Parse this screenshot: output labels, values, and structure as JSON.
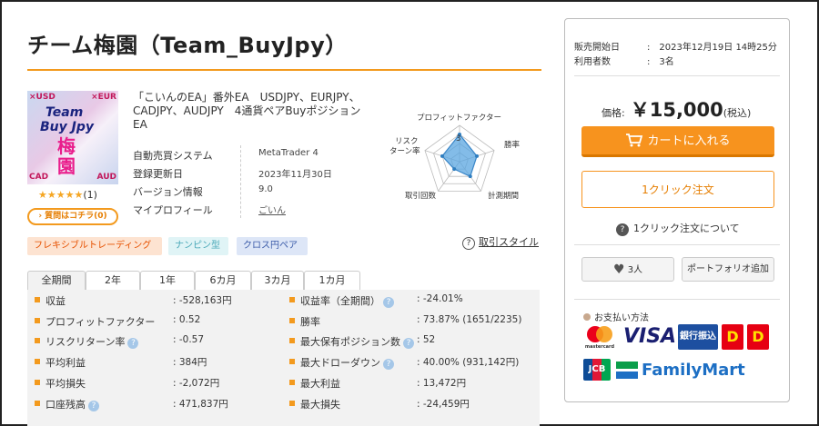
{
  "product": {
    "title": "チーム梅園（Team_BuyJpy）",
    "image_texts": {
      "tl": "×USD",
      "tr": "×EUR",
      "bl": "CAD",
      "br": "AUD",
      "line1": "Team",
      "line2": "Buy Jpy",
      "kanji": "梅園"
    },
    "stars": "★★★★★",
    "review_count": "(1)",
    "question_button": "質問はコチラ(0)",
    "description": "「こいんのEA」番外EA　USDJPY、EURJPY、CADJPY、AUDJPY　4通貨ペアBuyポジションEA"
  },
  "info": [
    {
      "key": "自動売買システム",
      "value": "MetaTrader 4"
    },
    {
      "key": "登録更新日",
      "value": "2023年11月30日"
    },
    {
      "key": "バージョン情報",
      "value": "9.0"
    },
    {
      "key": "マイプロフィール",
      "value": "ごいん"
    }
  ],
  "radar": {
    "axes": [
      "プロフィットファクター",
      "勝率",
      "計測期間",
      "取引回数",
      "リスク",
      "ターン率"
    ],
    "scale_label": "3",
    "values": [
      3,
      2,
      2,
      1,
      2
    ],
    "max": 4
  },
  "tags": [
    "フレキシブルトレーディング",
    "ナンピン型",
    "クロス円ペア"
  ],
  "trade_style_link": "取引スタイル",
  "tabs": [
    "全期間",
    "2年",
    "1年",
    "6カ月",
    "3カ月",
    "1カ月"
  ],
  "stats_left": [
    {
      "label": "収益",
      "value": ": -528,163円",
      "help": false
    },
    {
      "label": "プロフィットファクター",
      "value": ": 0.52",
      "help": false
    },
    {
      "label": "リスクリターン率",
      "value": ": -0.57",
      "help": true
    },
    {
      "label": "平均利益",
      "value": ": 384円",
      "help": false
    },
    {
      "label": "平均損失",
      "value": ": -2,072円",
      "help": false
    },
    {
      "label": "口座残高",
      "value": ": 471,837円",
      "help": true
    }
  ],
  "stats_right": [
    {
      "label": "収益率（全期間）",
      "value": ": -24.01%",
      "help": true
    },
    {
      "label": "勝率",
      "value": ": 73.87% (1651/2235)",
      "help": false
    },
    {
      "label": "最大保有ポジション数",
      "value": ": 52",
      "help": true
    },
    {
      "label": "最大ドローダウン",
      "value": ": 40.00% (931,142円)",
      "help": true
    },
    {
      "label": "最大利益",
      "value": ": 13,472円",
      "help": false
    },
    {
      "label": "最大損失",
      "value": ": -24,459円",
      "help": false
    }
  ],
  "sidebar": {
    "sale_start_label": "販売開始日",
    "sale_start_value": ":　2023年12月19日 14時25分",
    "users_label": "利用者数",
    "users_value": ":　3名",
    "price_label": "価格:",
    "price_value": "￥15,000",
    "price_tax": "(税込)",
    "cart_button": "カートに入れる",
    "oneclick_button": "1クリック注文",
    "oneclick_about": "1クリック注文について",
    "like_count": "3人",
    "portfolio_button": "ポートフォリオ追加",
    "payment_title": "お支払い方法",
    "payments_row1": [
      "mastercard",
      "VISA",
      "銀行振込",
      "D",
      "D"
    ],
    "payments_row2": [
      "JCB",
      "FamilyMart"
    ]
  },
  "colors": {
    "accent": "#f7931e",
    "title_line": "#f39a1e",
    "stats_bg": "#f2f2f2"
  }
}
